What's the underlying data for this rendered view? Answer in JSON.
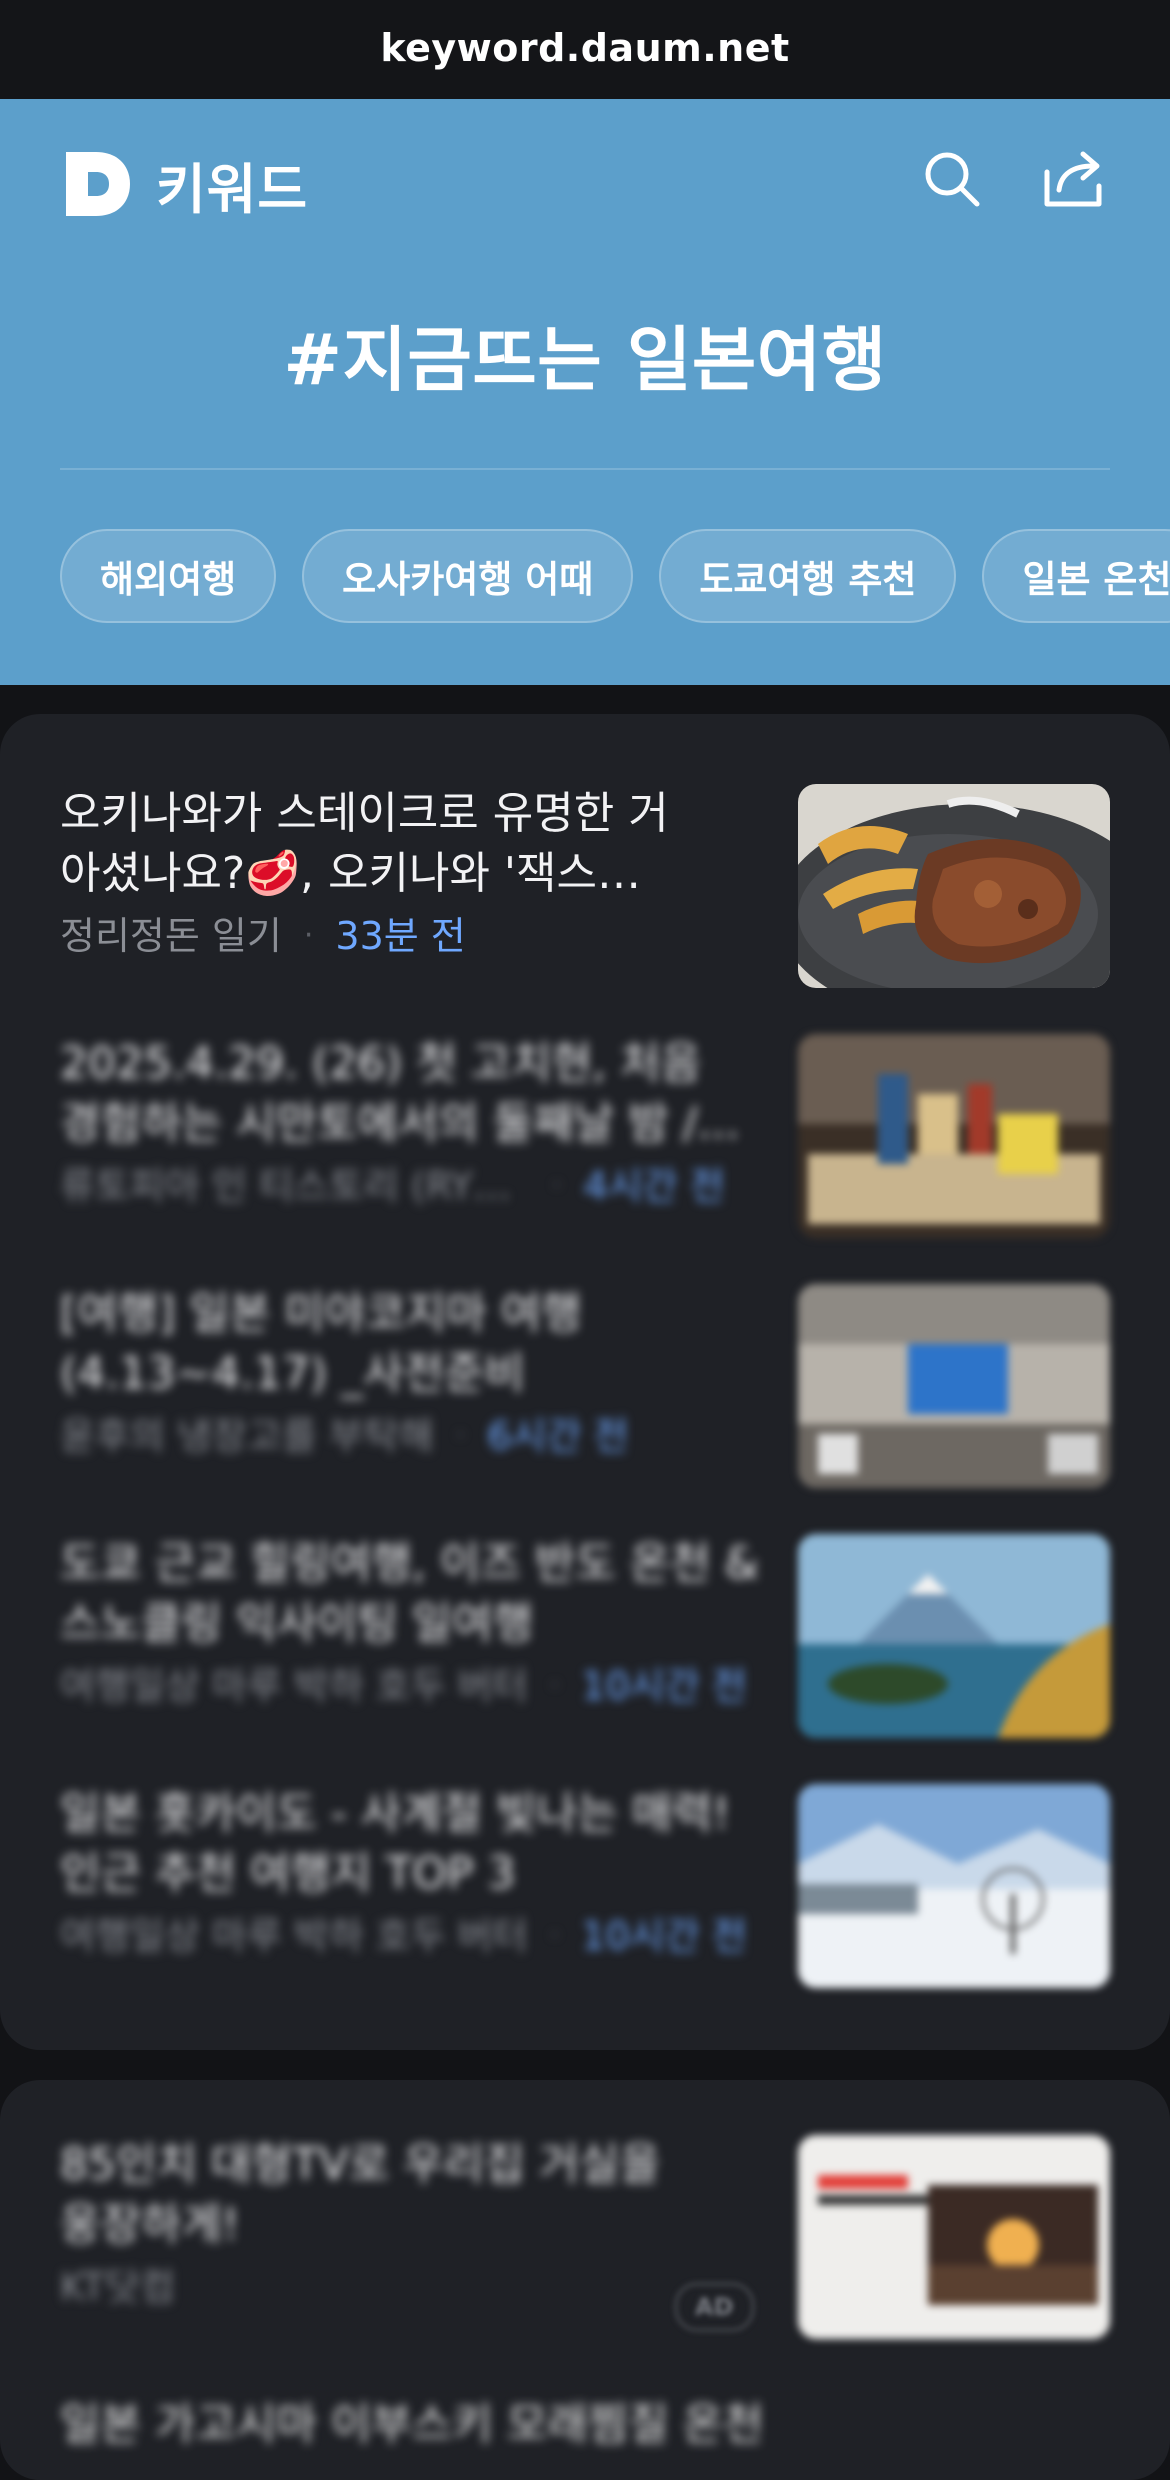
{
  "browser": {
    "url": "keyword.daum.net"
  },
  "header": {
    "brand_name": "키워드",
    "headline": "#지금뜨는 일본여행",
    "chips": [
      "해외여행",
      "오사카여행 어때",
      "도쿄여행 추천",
      "일본 온천"
    ]
  },
  "articles": [
    {
      "title": "오키나와가 스테이크로 유명한 거 아셨나요?🥩, 오키나와 '잭스 스테이크하우스'",
      "source": "정리정돈 일기",
      "time": "33분 전",
      "thumb_icon": "steak-photo"
    },
    {
      "title": "2025.4.29. (26) 첫 고치현, 처음 경험하는 시만토에서의 둘째날 밤 /...",
      "source": "류토피아 인 티스토리 (RYUTOPIA)",
      "time": "4시간 전",
      "thumb_icon": "snack-table-photo"
    },
    {
      "title": "[여행] 일본 미야코지마 여행 (4.13~4.17) _사전준비",
      "source": "윤후의 냉장고를 부탁해",
      "time": "6시간 전",
      "thumb_icon": "airport-photo"
    },
    {
      "title": "도쿄 근교 힐링여행, 이즈 반도 온천 & 스노클링 익사이팅 일여행",
      "source": "여행일상 마루 박하 호두 버터",
      "time": "10시간 전",
      "thumb_icon": "fuji-coast-photo"
    },
    {
      "title": "일본 홋카이도 - 사계절 빛나는 매력! 인근 추천 여행지 TOP 3",
      "source": "여행일상 마루 박하 호두 버터",
      "time": "10시간 전",
      "thumb_icon": "snow-field-photo"
    }
  ],
  "ad": {
    "title": "85인치 대형TV로 우리집 거실을 웅장하게!",
    "source": "KT닷컴",
    "badge": "AD"
  },
  "next_item_peek": "일본 가고시마 이부스키 모래찜질 온천"
}
